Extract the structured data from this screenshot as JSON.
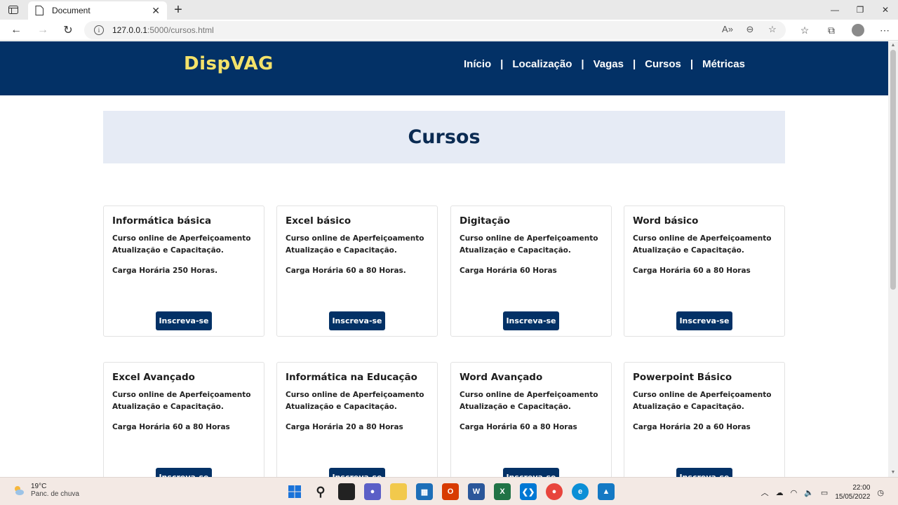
{
  "browser": {
    "tab_title": "Document",
    "url_host": "127.0.0.1",
    "url_path": ":5000/cursos.html"
  },
  "site": {
    "logo": "DispVAG",
    "nav": [
      "Início",
      "Localização",
      "Vagas",
      "Cursos",
      "Métricas"
    ],
    "page_title": "Cursos"
  },
  "courses": [
    {
      "title": "Informática básica",
      "desc1": "Curso online de Aperfeiçoamento",
      "desc2": "Atualização e Capacitação.",
      "hours": "Carga Horária 250 Horas.",
      "button": "Inscreva-se"
    },
    {
      "title": "Excel básico",
      "desc1": "Curso online de Aperfeiçoamento",
      "desc2": "Atualização e Capacitação.",
      "hours": "Carga Horária 60 a 80 Horas.",
      "button": "Inscreva-se"
    },
    {
      "title": "Digitação",
      "desc1": "Curso online de Aperfeiçoamento",
      "desc2": "Atualização e Capacitação.",
      "hours": "Carga Horária 60 Horas",
      "button": "Inscreva-se"
    },
    {
      "title": "Word básico",
      "desc1": "Curso online de Aperfeiçoamento",
      "desc2": "Atualização e Capacitação.",
      "hours": "Carga Horária 60 a 80 Horas",
      "button": "Inscreva-se"
    },
    {
      "title": "Excel Avançado",
      "desc1": "Curso online de Aperfeiçoamento",
      "desc2": "Atualização e Capacitação.",
      "hours": "Carga Horária 60 a 80 Horas",
      "button": "Inscreva-se"
    },
    {
      "title": "Informática na Educação",
      "desc1": "Curso online de Aperfeiçoamento",
      "desc2": "Atualização e Capacitação.",
      "hours": "Carga Horária 20 a 80 Horas",
      "button": "Inscreva-se"
    },
    {
      "title": "Word Avançado",
      "desc1": "Curso online de Aperfeiçoamento",
      "desc2": "Atualização e Capacitação.",
      "hours": "Carga Horária 60 a 80 Horas",
      "button": "Inscreva-se"
    },
    {
      "title": "Powerpoint Básico",
      "desc1": "Curso online de Aperfeiçoamento",
      "desc2": "Atualização e Capacitação.",
      "hours": "Carga Horária 20 a 60 Horas",
      "button": "Inscreva-se"
    }
  ],
  "taskbar": {
    "temperature": "19°C",
    "weather": "Panc. de chuva",
    "time": "22:00",
    "date": "15/05/2022"
  },
  "colors": {
    "header_bg": "#033166",
    "logo": "#f4e26a",
    "banner_bg": "#e6ebf5",
    "button_bg": "#033166"
  }
}
